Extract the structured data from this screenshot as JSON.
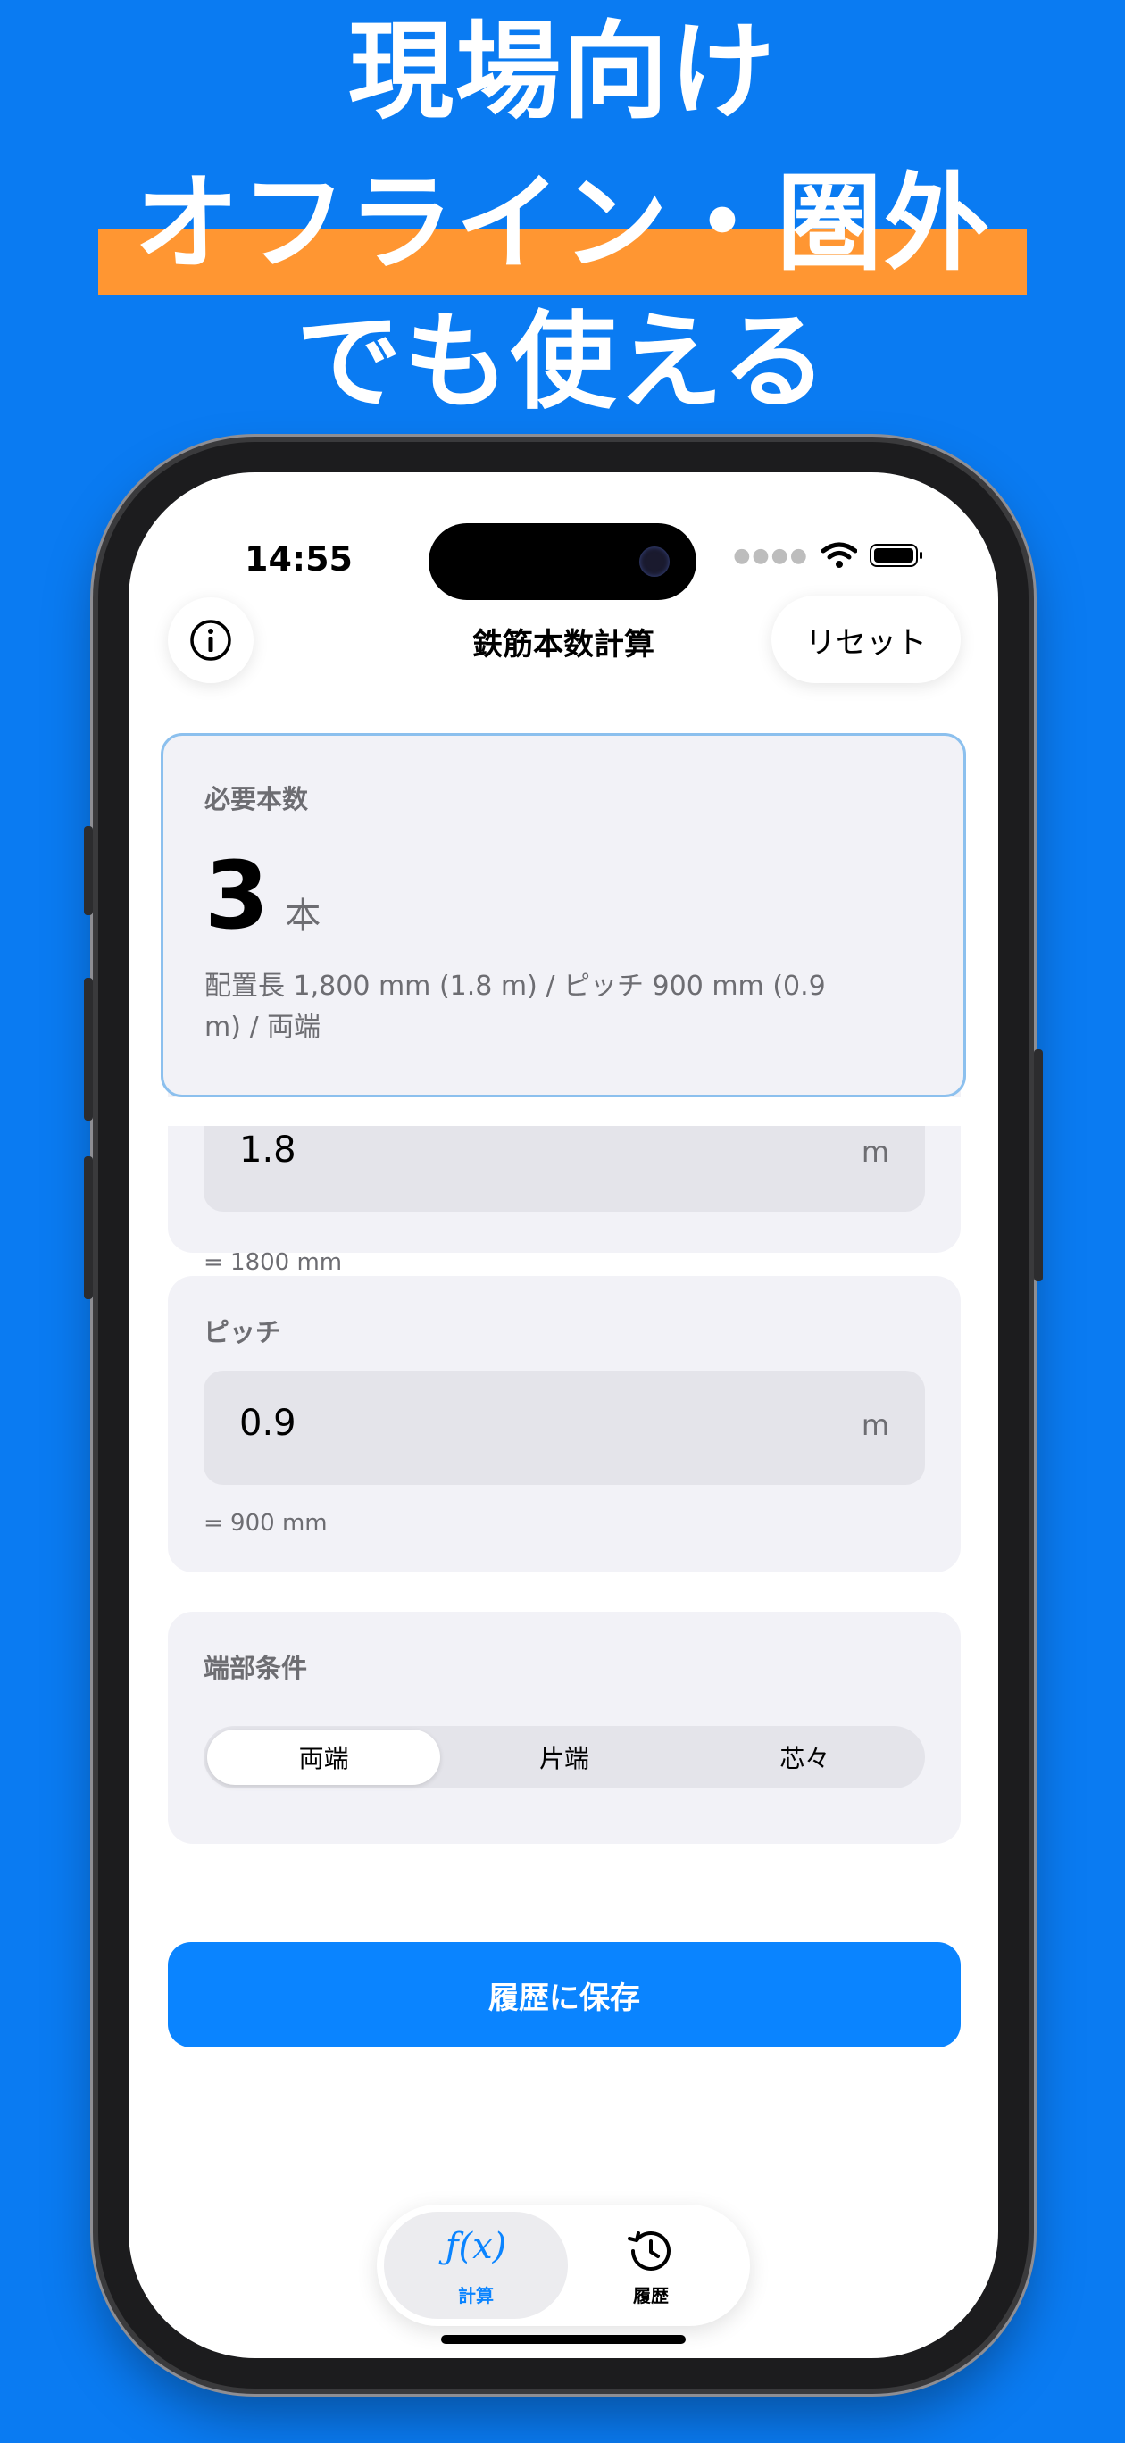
{
  "banner": {
    "line1": "現場向け",
    "line2": "オフライン・圏外",
    "line3": "でも使える",
    "highlight_color": "#ff9632",
    "background_color": "#0a7bf2"
  },
  "status_bar": {
    "time": "14:55",
    "signal_icon": "signal-dots-icon",
    "wifi_icon": "wifi-icon",
    "battery_icon": "battery-icon"
  },
  "nav": {
    "title": "鉄筋本数計算",
    "reset_label": "リセット",
    "info_icon": "info-icon"
  },
  "result": {
    "label": "必要本数",
    "count": "3",
    "unit": "本",
    "detail": "配置長 1,800 mm (1.8 m) / ピッチ 900 mm (0.9 m) / 両端"
  },
  "length_card": {
    "value": "1.8",
    "unit": "m",
    "converted": "= 1800 mm"
  },
  "pitch_card": {
    "label": "ピッチ",
    "value": "0.9",
    "unit": "m",
    "converted": "= 900 mm"
  },
  "end_condition": {
    "label": "端部条件",
    "options": [
      "両端",
      "片端",
      "芯々"
    ],
    "selected": "両端"
  },
  "save_button": {
    "label": "履歴に保存",
    "color": "#0a84ff"
  },
  "tabbar": {
    "tabs": [
      {
        "label": "計算",
        "icon": "function-icon",
        "active": true
      },
      {
        "label": "履歴",
        "icon": "history-icon",
        "active": false
      }
    ],
    "accent_color": "#0a84ff"
  }
}
